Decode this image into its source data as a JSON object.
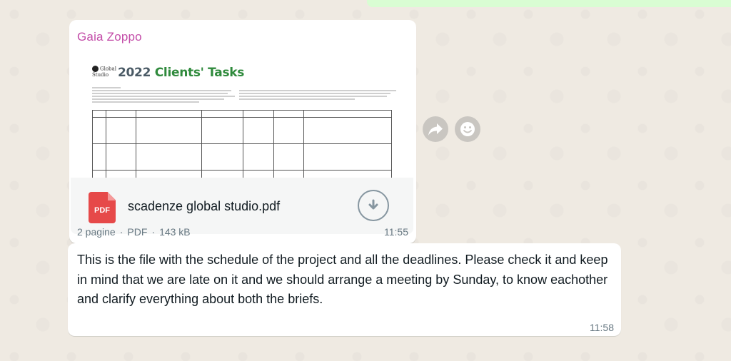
{
  "file_message": {
    "sender": "Gaia Zoppo",
    "preview": {
      "logo_text": "Global Studio",
      "title_year": "2022",
      "title_text": "Clients' Tasks"
    },
    "file_name": "scadenze global studio.pdf",
    "file_type_badge": "PDF",
    "meta": {
      "pages": "2 pagine",
      "type": "PDF",
      "size": "143 kB"
    },
    "time": "11:55"
  },
  "text_message": {
    "text": "This is the file with the schedule of the project and all the deadlines. Please check it and keep in mind that we are late on it and we should arrange a meeting by Sunday, to know eachother and clarify everything about both the briefs.",
    "time": "11:58"
  },
  "actions": {
    "forward_icon": "forward-icon",
    "emoji_icon": "emoji-icon",
    "download_icon": "download-icon",
    "pdf_icon": "pdf-icon"
  },
  "colors": {
    "background": "#efeae2",
    "sender_name": "#c34ca8",
    "outgoing_bubble": "#d9fdd3",
    "pdf_red": "#e64949"
  }
}
